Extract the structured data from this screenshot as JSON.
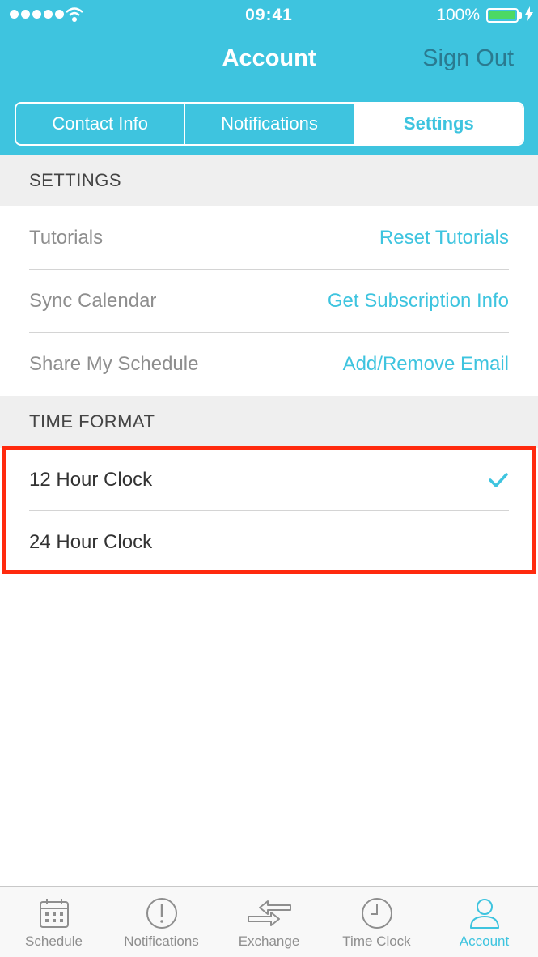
{
  "status_bar": {
    "time": "09:41",
    "battery": "100%"
  },
  "nav": {
    "title": "Account",
    "sign_out": "Sign Out"
  },
  "segments": [
    {
      "label": "Contact Info",
      "active": false
    },
    {
      "label": "Notifications",
      "active": false
    },
    {
      "label": "Settings",
      "active": true
    }
  ],
  "settings_section": {
    "header": "SETTINGS",
    "rows": [
      {
        "label": "Tutorials",
        "action": "Reset Tutorials"
      },
      {
        "label": "Sync Calendar",
        "action": "Get Subscription Info"
      },
      {
        "label": "Share My Schedule",
        "action": "Add/Remove Email"
      }
    ]
  },
  "time_format_section": {
    "header": "TIME FORMAT",
    "options": [
      {
        "label": "12 Hour Clock",
        "selected": true
      },
      {
        "label": "24 Hour Clock",
        "selected": false
      }
    ]
  },
  "tabbar": {
    "items": [
      {
        "label": "Schedule",
        "icon": "calendar-icon",
        "active": false
      },
      {
        "label": "Notifications",
        "icon": "alert-icon",
        "active": false
      },
      {
        "label": "Exchange",
        "icon": "exchange-icon",
        "active": false
      },
      {
        "label": "Time Clock",
        "icon": "clock-icon",
        "active": false
      },
      {
        "label": "Account",
        "icon": "person-icon",
        "active": true
      }
    ]
  },
  "colors": {
    "accent": "#3ec4df",
    "highlight": "#ff2a0e",
    "battery": "#4cd964"
  }
}
